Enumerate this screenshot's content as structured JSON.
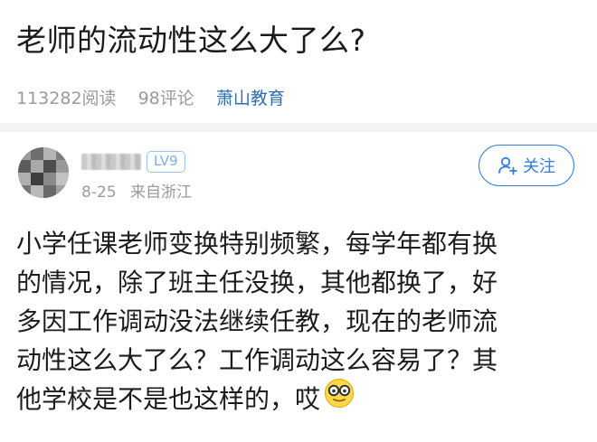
{
  "article": {
    "title": "老师的流动性这么大了么?",
    "reads": "113282阅读",
    "comments": "98评论",
    "source": "萧山教育"
  },
  "author": {
    "level": "LV9",
    "date": "8-25",
    "location": "来自浙江",
    "follow_label": "关注"
  },
  "post": {
    "lines": [
      "小学任课老师变换特别频繁，每学年都有换",
      "的情况，除了班主任没换，其他都换了，好",
      "多因工作调动没法继续任教，现在的老师流",
      "动性这么大了么？工作调动这么容易了？其",
      "他学校是不是也这样的，哎"
    ]
  },
  "icons": {
    "follow": "add-user-icon",
    "emoji": "nerd-face-emoji-icon"
  },
  "colors": {
    "accent": "#2f7de1",
    "source_link": "#2f6fad",
    "level_badge": "#7ab0ea"
  }
}
